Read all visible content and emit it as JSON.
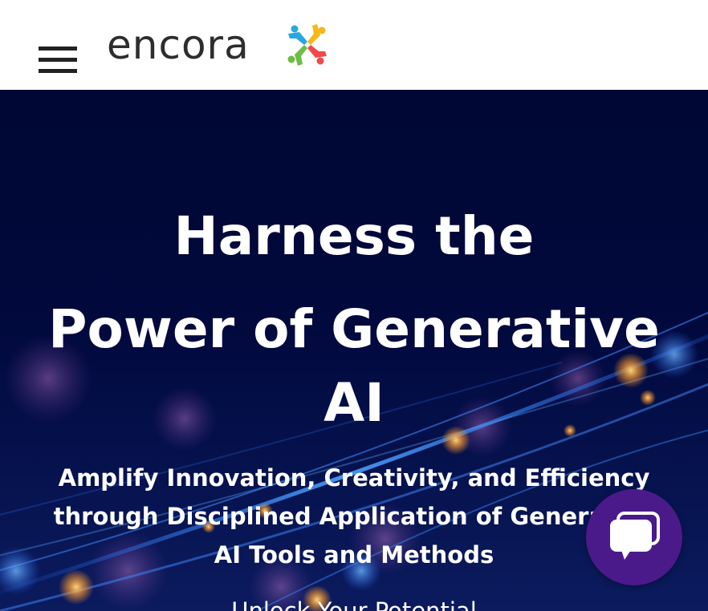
{
  "header": {
    "logo_text": "encora",
    "menu_icon": "hamburger-menu-icon"
  },
  "hero": {
    "title_line1": "Harness the",
    "title_line2": "Power of Generative",
    "title_line3": "AI",
    "subtitle": "Amplify Innovation, Creativity, and Efficiency through Disciplined Application of Generative AI Tools and Methods",
    "cta_partial": "Unlock Your Potential"
  },
  "chat": {
    "icon": "chat-bubbles-icon",
    "color": "#4a1a8a"
  },
  "colors": {
    "header_bg": "#ffffff",
    "hero_bg": "#000936",
    "logo_text": "#2d2d2d",
    "logo_blue": "#2aa7e0",
    "logo_yellow": "#f5b81c",
    "logo_green": "#6cbe45",
    "logo_red": "#ee4a4a"
  }
}
